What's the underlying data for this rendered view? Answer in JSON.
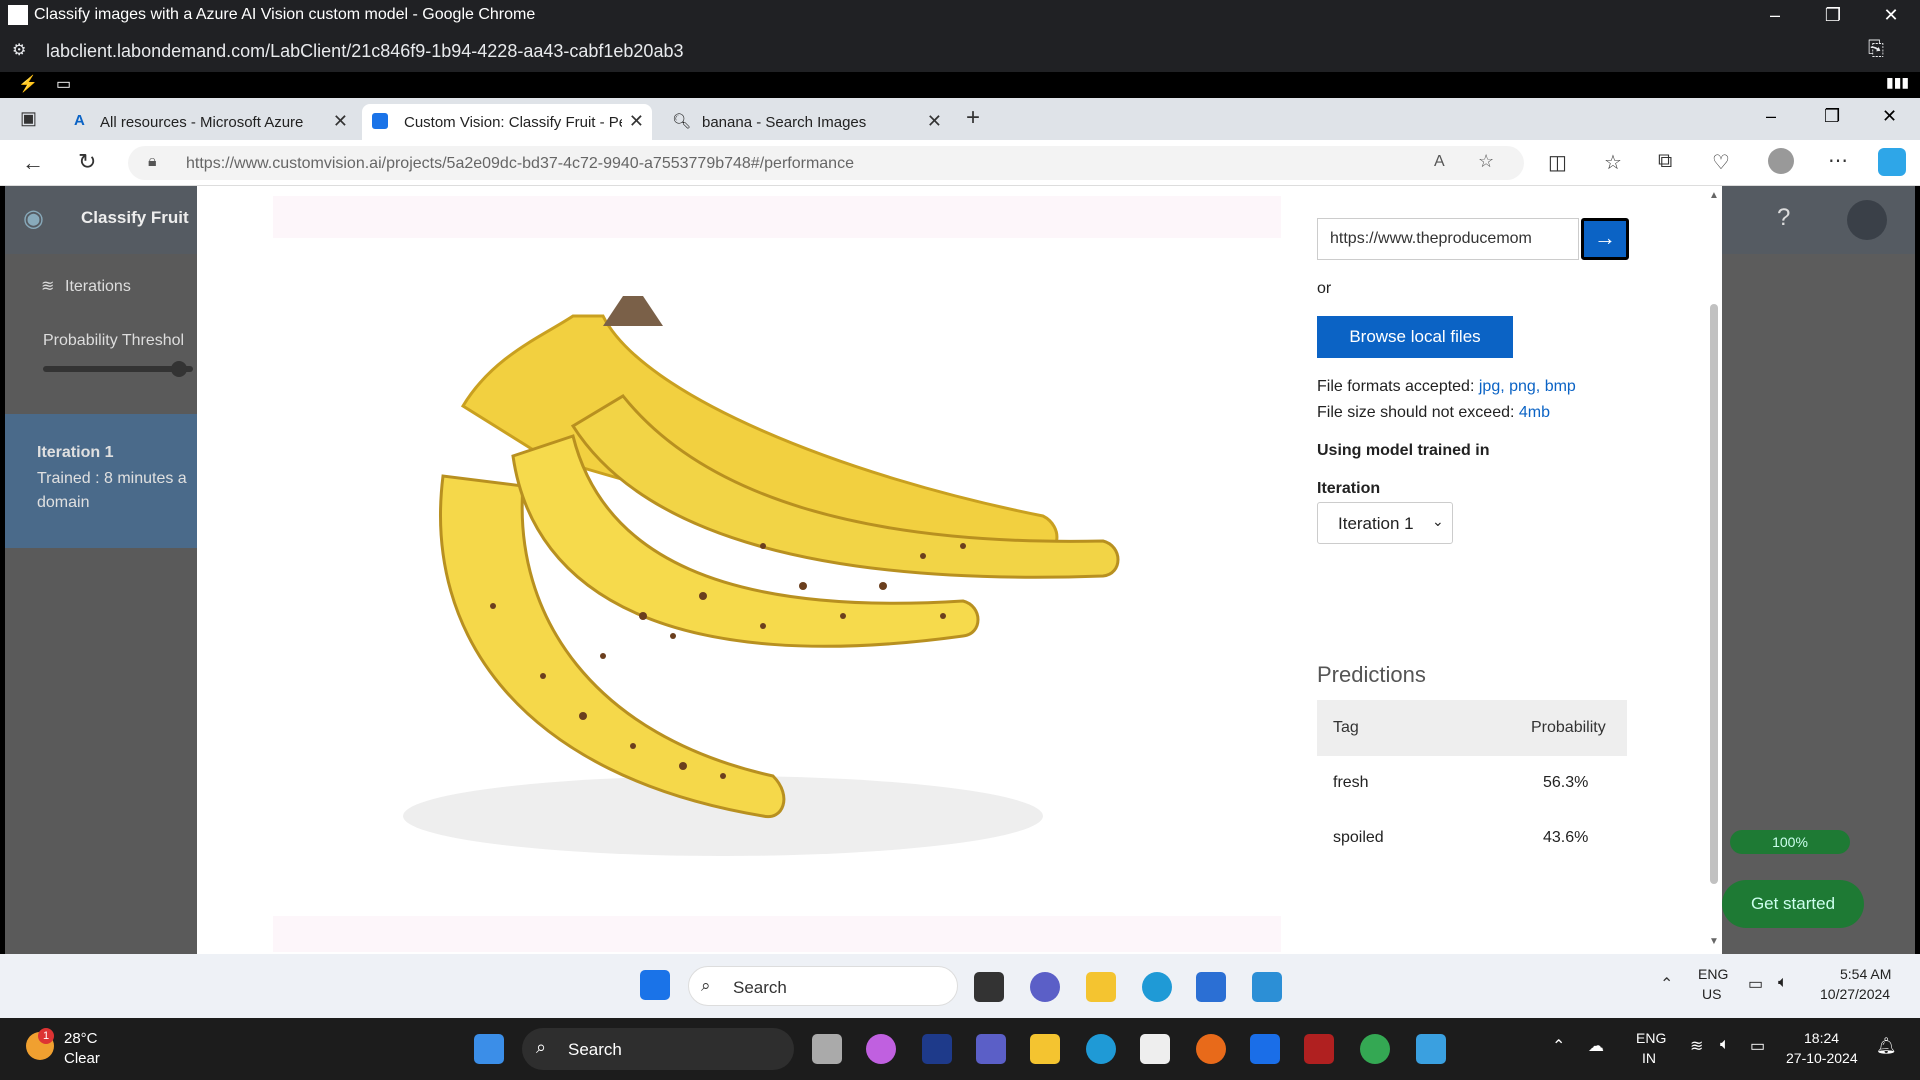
{
  "outer_window": {
    "title": "Classify images with a Azure AI Vision custom model - Google Chrome",
    "url": "labclient.labondemand.com/LabClient/21c846f9-1b94-4228-aa43-cabf1eb20ab3"
  },
  "edge": {
    "tabs": [
      {
        "label": "All resources - Microsoft Azure"
      },
      {
        "label": "Custom Vision: Classify Fruit - Pe"
      },
      {
        "label": "banana - Search Images"
      }
    ],
    "url": "https://www.customvision.ai/projects/5a2e09dc-bd37-4c72-9940-a7553779b748#/performance"
  },
  "page": {
    "project_name": "Classify Fruit",
    "iterations_label": "Iterations",
    "probability_label": "Probability Threshol",
    "iteration_card": {
      "title": "Iteration 1",
      "line1": "Trained : 8 minutes a",
      "line2": "domain"
    },
    "progress_text": "100%",
    "get_started_label": "Get started"
  },
  "modal": {
    "image_url_value": "https://www.theproducemom",
    "or_label": "or",
    "browse_label": "Browse local files",
    "formats_label": "File formats accepted:",
    "formats_links": "jpg, png, bmp",
    "size_label": "File size should not exceed:",
    "size_value": "4mb",
    "using_model_label": "Using model trained in",
    "iteration_label": "Iteration",
    "iteration_selected": "Iteration 1",
    "predictions_title": "Predictions",
    "table": {
      "headers": [
        "Tag",
        "Probability"
      ],
      "rows": [
        {
          "tag": "fresh",
          "probability": "56.3%"
        },
        {
          "tag": "spoiled",
          "probability": "43.6%"
        }
      ]
    }
  },
  "inner_taskbar": {
    "search_label": "Search",
    "lang1": "ENG",
    "lang2": "US",
    "time": "5:54 AM",
    "date": "10/27/2024"
  },
  "outer_taskbar": {
    "weather_temp": "28°C",
    "weather_desc": "Clear",
    "weather_badge": "1",
    "search_label": "Search",
    "lang1": "ENG",
    "lang2": "IN",
    "time": "18:24",
    "date": "27-10-2024"
  }
}
